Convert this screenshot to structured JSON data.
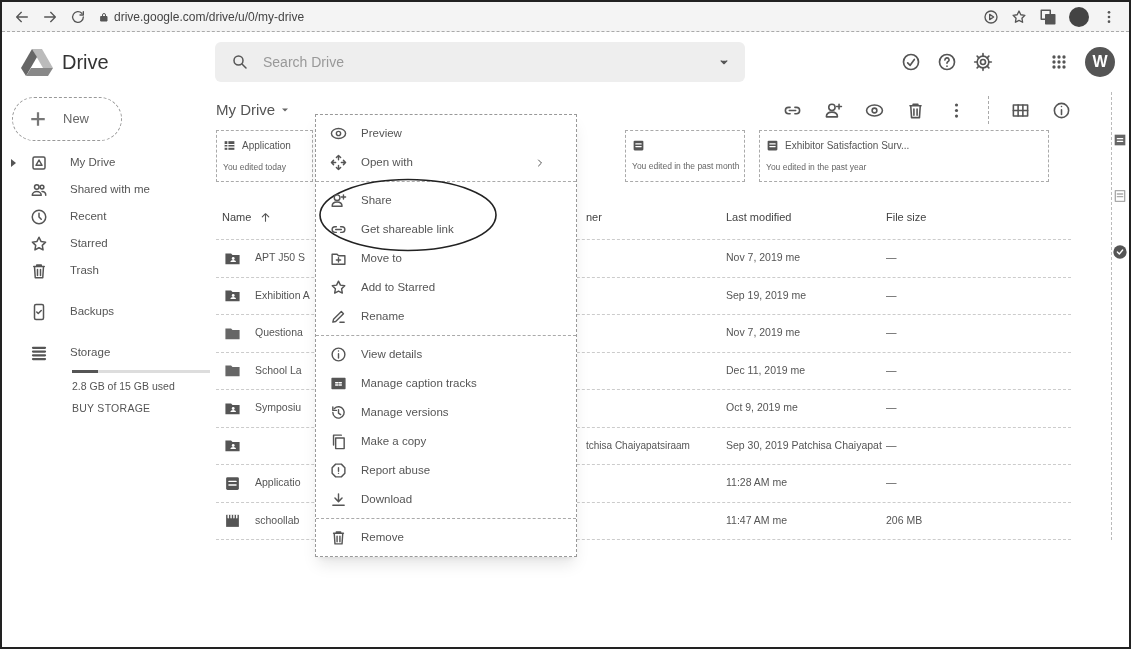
{
  "browser": {
    "url": "drive.google.com/drive/u/0/my-drive"
  },
  "header": {
    "app_name": "Drive",
    "search": {
      "placeholder": "Search Drive"
    },
    "avatar": "W"
  },
  "sidebar": {
    "new_button": "New",
    "items": [
      {
        "label": "My Drive",
        "expandable": true
      },
      {
        "label": "Shared with me",
        "expandable": false
      },
      {
        "label": "Recent",
        "expandable": false
      },
      {
        "label": "Starred",
        "expandable": false
      },
      {
        "label": "Trash",
        "expandable": false
      },
      {
        "label": "Backups",
        "expandable": false
      },
      {
        "label": "Storage",
        "expandable": false
      }
    ],
    "storage": {
      "level": 0.19,
      "used": "2.8 GB of 15 GB used",
      "buy": "BUY STORAGE"
    }
  },
  "location": "My Drive",
  "quick_access": [
    {
      "title": "Application",
      "subtitle": "You edited today"
    },
    {
      "subtitle": "You edited in the past month"
    },
    {
      "title": "Exhibitor Satisfaction Surv...",
      "subtitle": "You edited in the past year"
    }
  ],
  "table": {
    "columns": [
      "Name",
      "ner",
      "Last modified",
      "File size"
    ],
    "rows": [
      {
        "kind": "shared-folder",
        "name": "APT J50 S",
        "modified": "Nov 7, 2019 me",
        "size": "—"
      },
      {
        "kind": "shared-folder",
        "name": "Exhibition A",
        "modified": "Sep 19, 2019 me",
        "size": "—"
      },
      {
        "kind": "folder",
        "name": "Questiona",
        "modified": "Nov 7, 2019 me",
        "size": "—"
      },
      {
        "kind": "folder",
        "name": "School La",
        "modified": "Dec 11, 2019 me",
        "size": "—"
      },
      {
        "kind": "shared-folder",
        "name": "Symposiu",
        "modified": "Oct 9, 2019 me",
        "size": "—"
      },
      {
        "kind": "shared-folder",
        "owner": "tchisa Chaiyapatsiraam",
        "modified": "Sep 30, 2019 Patchisa Chaiyapat",
        "size": "—"
      },
      {
        "kind": "form",
        "name": "Applicatio",
        "modified": "11:28 AM me",
        "size": "—"
      },
      {
        "kind": "video",
        "name": "schoollab",
        "modified": "11:47 AM me",
        "size": "206 MB"
      }
    ]
  },
  "context_menu": {
    "groups": [
      [
        {
          "label": "Preview",
          "submenu": false,
          "circled": false
        },
        {
          "label": "Open with",
          "submenu": true,
          "circled": false
        }
      ],
      [
        {
          "label": "Share",
          "submenu": false,
          "circled": true
        },
        {
          "label": "Get shareable link",
          "submenu": false,
          "circled": true
        },
        {
          "label": "Move to",
          "submenu": false,
          "circled": false
        },
        {
          "label": "Add to Starred",
          "submenu": false,
          "circled": false
        },
        {
          "label": "Rename",
          "submenu": false,
          "circled": false
        }
      ],
      [
        {
          "label": "View details",
          "submenu": false,
          "circled": false
        },
        {
          "label": "Manage caption tracks",
          "submenu": false,
          "circled": false
        },
        {
          "label": "Manage versions",
          "submenu": false,
          "circled": false
        },
        {
          "label": "Make a copy",
          "submenu": false,
          "circled": false
        },
        {
          "label": "Report abuse",
          "submenu": false,
          "circled": false
        },
        {
          "label": "Download",
          "submenu": false,
          "circled": false
        }
      ],
      [
        {
          "label": "Remove",
          "submenu": false,
          "circled": false
        }
      ]
    ]
  }
}
